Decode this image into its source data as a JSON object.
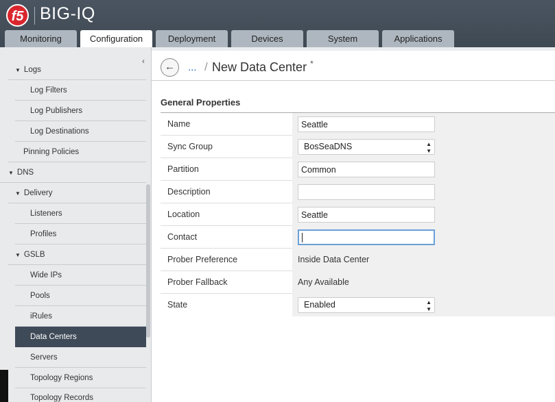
{
  "app": {
    "logo_text": "f5",
    "title": "BIG-IQ"
  },
  "tabs": [
    {
      "label": "Monitoring"
    },
    {
      "label": "Configuration"
    },
    {
      "label": "Deployment"
    },
    {
      "label": "Devices"
    },
    {
      "label": "System"
    },
    {
      "label": "Applications"
    }
  ],
  "active_tab": "Configuration",
  "sidebar": {
    "collapse_icon": "chevron-left-icon",
    "items": [
      {
        "label": "Logs"
      },
      {
        "label": "Log Filters"
      },
      {
        "label": "Log Publishers"
      },
      {
        "label": "Log Destinations"
      },
      {
        "label": "Pinning Policies"
      },
      {
        "label": "DNS"
      },
      {
        "label": "Delivery"
      },
      {
        "label": "Listeners"
      },
      {
        "label": "Profiles"
      },
      {
        "label": "GSLB"
      },
      {
        "label": "Wide IPs"
      },
      {
        "label": "Pools"
      },
      {
        "label": "iRules"
      },
      {
        "label": "Data Centers"
      },
      {
        "label": "Servers"
      },
      {
        "label": "Topology Regions"
      },
      {
        "label": "Topology Records"
      }
    ],
    "selected": "Data Centers"
  },
  "breadcrumb": {
    "ellipsis": "...",
    "separator": "/"
  },
  "page": {
    "title": "New Data Center",
    "unsaved_marker": "*"
  },
  "section": {
    "title": "General Properties"
  },
  "form": {
    "name": {
      "label": "Name",
      "value": "Seattle"
    },
    "sync_group": {
      "label": "Sync Group",
      "value": "BosSeaDNS"
    },
    "partition": {
      "label": "Partition",
      "value": "Common"
    },
    "description": {
      "label": "Description",
      "value": ""
    },
    "location": {
      "label": "Location",
      "value": "Seattle"
    },
    "contact": {
      "label": "Contact",
      "value": ""
    },
    "prober_preference": {
      "label": "Prober Preference",
      "value": "Inside Data Center"
    },
    "prober_fallback": {
      "label": "Prober Fallback",
      "value": "Any Available"
    },
    "state": {
      "label": "State",
      "value": "Enabled"
    }
  },
  "colors": {
    "header": "#434d57",
    "tab_inactive": "#aeb7bf",
    "sidebar_bg": "#e9eaec",
    "selected_item": "#3f4a58",
    "link": "#1a66c9",
    "logo_red": "#d9262e",
    "focus_border": "#6a9fd8"
  }
}
